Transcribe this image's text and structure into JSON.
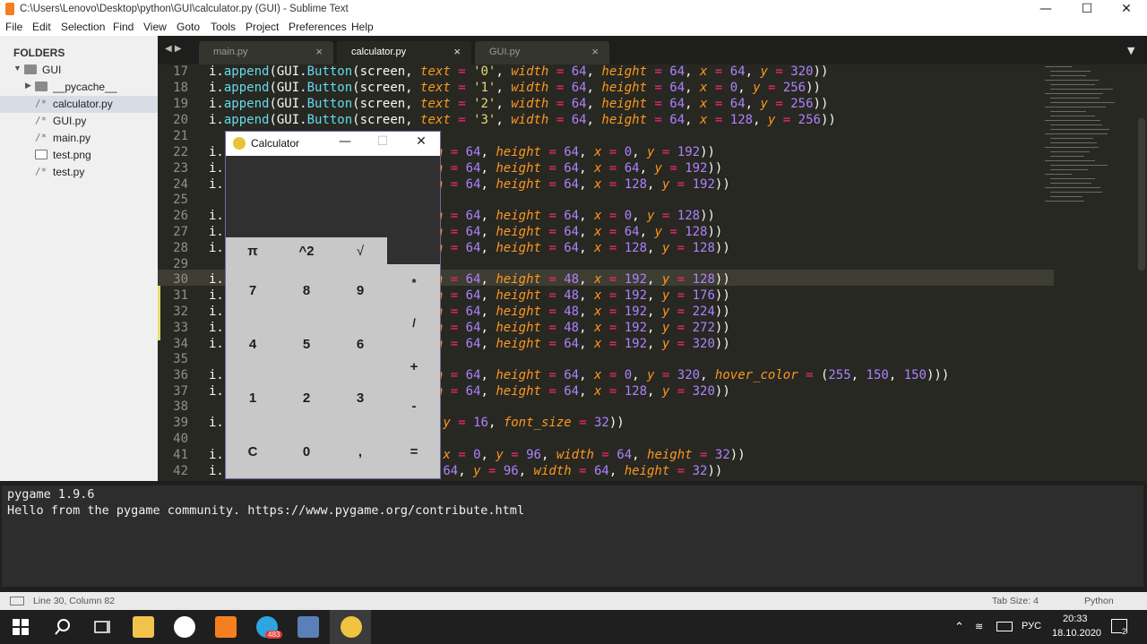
{
  "window": {
    "title": "C:\\Users\\Lenovo\\Desktop\\python\\GUI\\calculator.py (GUI) - Sublime Text",
    "minimize": "—",
    "maximize": "☐",
    "close": "✕"
  },
  "menu": [
    "File",
    "Edit",
    "Selection",
    "Find",
    "View",
    "Goto",
    "Tools",
    "Project",
    "Preferences",
    "Help"
  ],
  "sidebar": {
    "title": "FOLDERS",
    "items": [
      {
        "label": "GUI",
        "type": "folder-open"
      },
      {
        "label": "__pycache__",
        "type": "folder"
      },
      {
        "label": "calculator.py",
        "type": "file",
        "selected": true
      },
      {
        "label": "GUI.py",
        "type": "file"
      },
      {
        "label": "main.py",
        "type": "file"
      },
      {
        "label": "test.png",
        "type": "image"
      },
      {
        "label": "test.py",
        "type": "file"
      }
    ],
    "file_glyph": "/*"
  },
  "tabs": [
    {
      "label": "main.py"
    },
    {
      "label": "calculator.py",
      "active": true
    },
    {
      "label": "GUI.py"
    }
  ],
  "tab_close": "×",
  "tab_nav": "◀ ▶",
  "tab_dropdown": "▼",
  "editor": {
    "line_numbers": [
      "17",
      "18",
      "19",
      "20",
      "21",
      "22",
      "23",
      "24",
      "25",
      "26",
      "27",
      "28",
      "29",
      "30",
      "31",
      "32",
      "33",
      "34",
      "35",
      "36",
      "37",
      "38",
      "39",
      "40",
      "41",
      "42"
    ]
  },
  "calculator": {
    "title": "Calculator",
    "minimize": "—",
    "maximize": "☐",
    "close": "✕",
    "top_row": [
      "π",
      "^2",
      "√"
    ],
    "digits": [
      [
        "7",
        "8",
        "9"
      ],
      [
        "4",
        "5",
        "6"
      ],
      [
        "1",
        "2",
        "3"
      ],
      [
        "C",
        "0",
        ","
      ]
    ],
    "ops": [
      "*",
      "/",
      "+",
      "-",
      "="
    ]
  },
  "console": {
    "lines": [
      "pygame 1.9.6",
      "Hello from the pygame community. https://www.pygame.org/contribute.html"
    ]
  },
  "status": {
    "position": "Line 30, Column 82",
    "tab_size": "Tab Size: 4",
    "syntax": "Python"
  },
  "taskbar": {
    "language": "РУС",
    "time": "20:33",
    "date": "18.10.2020",
    "telegram_badge": "483",
    "notif_count": "2"
  }
}
